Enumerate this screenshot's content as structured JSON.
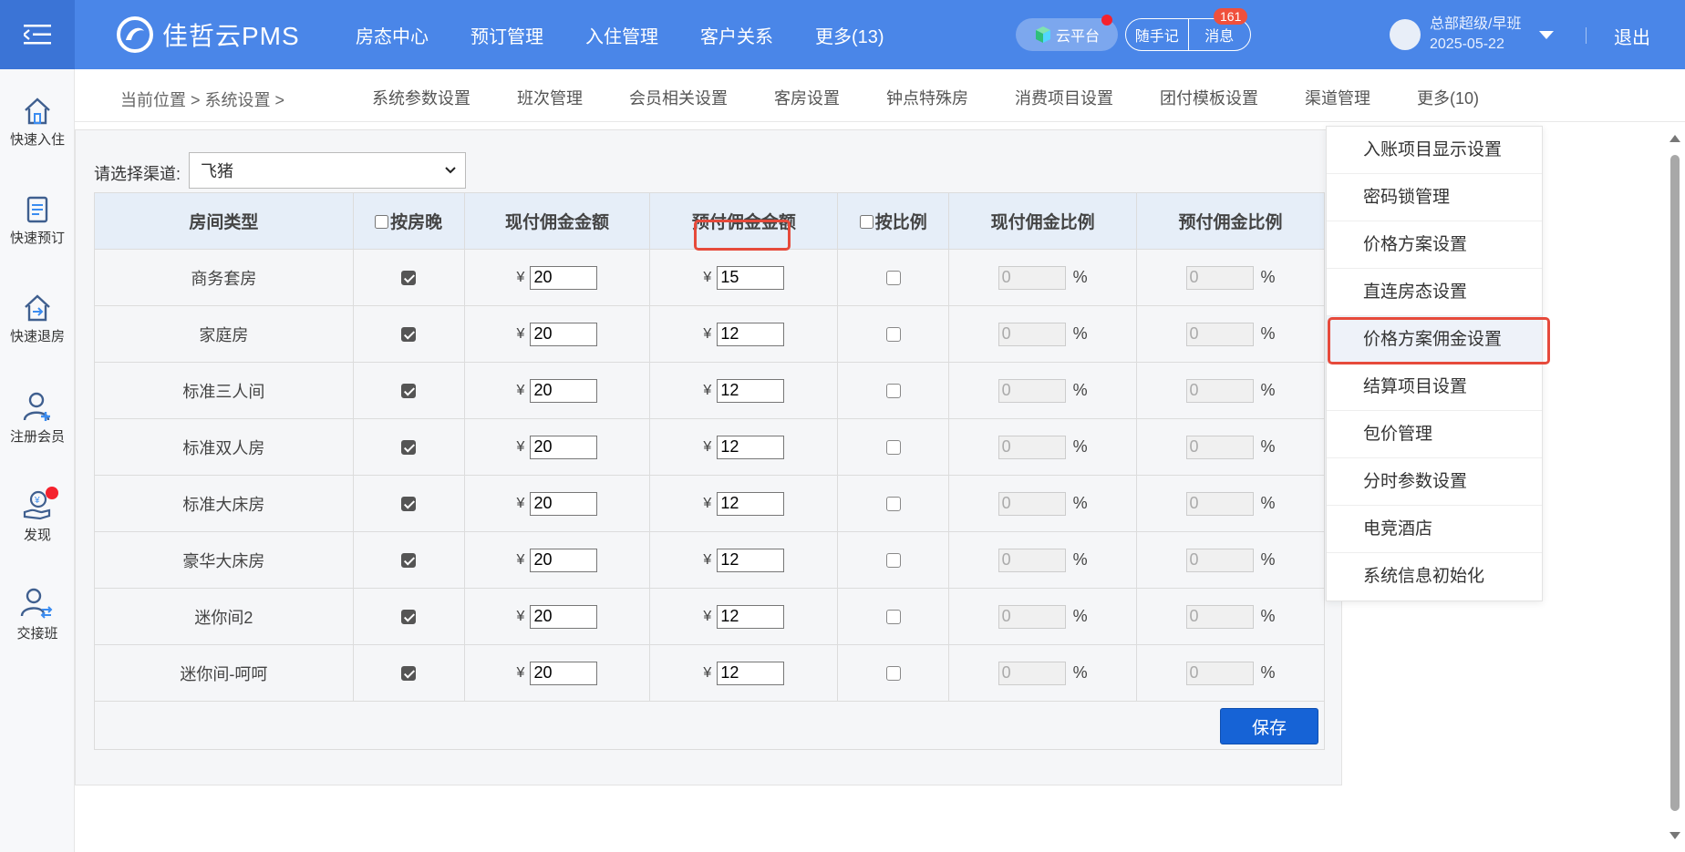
{
  "header": {
    "brand": "佳哲云PMS",
    "nav": [
      "房态中心",
      "预订管理",
      "入住管理",
      "客户关系",
      "更多(13)"
    ],
    "cloud_label": "云平台",
    "memo_label": "随手记",
    "message_label": "消息",
    "message_count": "161",
    "user_name": "总部超级/早班",
    "user_date": "2025-05-22",
    "logout": "退出",
    "colors": {
      "bar": "#4a86e8",
      "badge": "#f0503c"
    }
  },
  "sidebar": {
    "items": [
      {
        "label": "快速入住",
        "icon": "home-icon"
      },
      {
        "label": "快速预订",
        "icon": "clipboard-icon"
      },
      {
        "label": "快速退房",
        "icon": "checkout-icon"
      },
      {
        "label": "注册会员",
        "icon": "add-user-icon"
      },
      {
        "label": "发现",
        "icon": "discover-icon"
      },
      {
        "label": "交接班",
        "icon": "handover-icon"
      }
    ]
  },
  "subnav": {
    "breadcrumb": "当前位置 > 系统设置 >",
    "tabs": [
      "系统参数设置",
      "班次管理",
      "会员相关设置",
      "客房设置",
      "钟点特殊房",
      "消费项目设置",
      "团付模板设置",
      "渠道管理",
      "更多(10)"
    ]
  },
  "filter": {
    "label": "请选择渠道:",
    "selected": "飞猪"
  },
  "table": {
    "headers": [
      "房间类型",
      "按房晚",
      "现付佣金金额",
      "预付佣金金额",
      "按比例",
      "现付佣金比例",
      "预付佣金比例"
    ],
    "currency": "¥",
    "percent": "%",
    "rows": [
      {
        "type": "商务套房",
        "by_night": true,
        "cash": "20",
        "prepaid": "15",
        "by_ratio": false,
        "cash_ratio": "0",
        "prepaid_ratio": "0"
      },
      {
        "type": "家庭房",
        "by_night": true,
        "cash": "20",
        "prepaid": "12",
        "by_ratio": false,
        "cash_ratio": "0",
        "prepaid_ratio": "0"
      },
      {
        "type": "标准三人间",
        "by_night": true,
        "cash": "20",
        "prepaid": "12",
        "by_ratio": false,
        "cash_ratio": "0",
        "prepaid_ratio": "0"
      },
      {
        "type": "标准双人房",
        "by_night": true,
        "cash": "20",
        "prepaid": "12",
        "by_ratio": false,
        "cash_ratio": "0",
        "prepaid_ratio": "0"
      },
      {
        "type": "标准大床房",
        "by_night": true,
        "cash": "20",
        "prepaid": "12",
        "by_ratio": false,
        "cash_ratio": "0",
        "prepaid_ratio": "0"
      },
      {
        "type": "豪华大床房",
        "by_night": true,
        "cash": "20",
        "prepaid": "12",
        "by_ratio": false,
        "cash_ratio": "0",
        "prepaid_ratio": "0"
      },
      {
        "type": "迷你间2",
        "by_night": true,
        "cash": "20",
        "prepaid": "12",
        "by_ratio": false,
        "cash_ratio": "0",
        "prepaid_ratio": "0"
      },
      {
        "type": "迷你间-呵呵",
        "by_night": true,
        "cash": "20",
        "prepaid": "12",
        "by_ratio": false,
        "cash_ratio": "0",
        "prepaid_ratio": "0"
      }
    ],
    "save_label": "保存"
  },
  "more_menu": {
    "items": [
      "入账项目显示设置",
      "密码锁管理",
      "价格方案设置",
      "直连房态设置",
      "价格方案佣金设置",
      "结算项目设置",
      "包价管理",
      "分时参数设置",
      "电竞酒店",
      "系统信息初始化"
    ],
    "active_index": 4
  }
}
